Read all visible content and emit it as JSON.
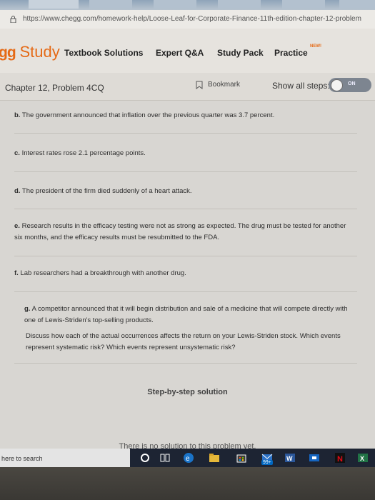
{
  "browser": {
    "url": "https://www.chegg.com/homework-help/Loose-Leaf-for-Corporate-Finance-11th-edition-chapter-12-problem"
  },
  "nav": {
    "logo_gg": "gg",
    "logo_study": "Study",
    "links": [
      "Textbook Solutions",
      "Expert Q&A",
      "Study Pack",
      "Practice"
    ],
    "new_badge": "NEW!"
  },
  "subheader": {
    "chapter": "Chapter 12, Problem 4CQ",
    "bookmark": "Bookmark",
    "show_steps": "Show all steps:",
    "toggle_label": "ON"
  },
  "questions": {
    "b_label": "b.",
    "b_text": "The government announced that inflation over the previous quarter was 3.7 percent.",
    "c_label": "c.",
    "c_text": "Interest rates rose 2.1 percentage points.",
    "d_label": "d.",
    "d_text": "The president of the firm died suddenly of a heart attack.",
    "e_label": "e.",
    "e_text": "Research results in the efficacy testing were not as strong as expected. The drug must be tested for another six months, and the efficacy results must be resubmitted to the FDA.",
    "f_label": "f.",
    "f_text": "Lab researchers had a breakthrough with another drug.",
    "g_label": "g.",
    "g_text": "A competitor announced that it will begin distribution and sale of a medicine that will compete directly with one of Lewis-Striden's top-selling products.",
    "discuss": "Discuss how each of the actual occurrences affects the return on your Lewis-Striden stock. Which events represent systematic risk? Which events represent unsystematic risk?"
  },
  "solution": {
    "title": "Step-by-step solution",
    "none": "There is no solution to this problem yet."
  },
  "taskbar": {
    "search": "here to search",
    "badge": "99+"
  },
  "colors": {
    "brand": "#e56a16",
    "taskbar": "#1d2433"
  }
}
